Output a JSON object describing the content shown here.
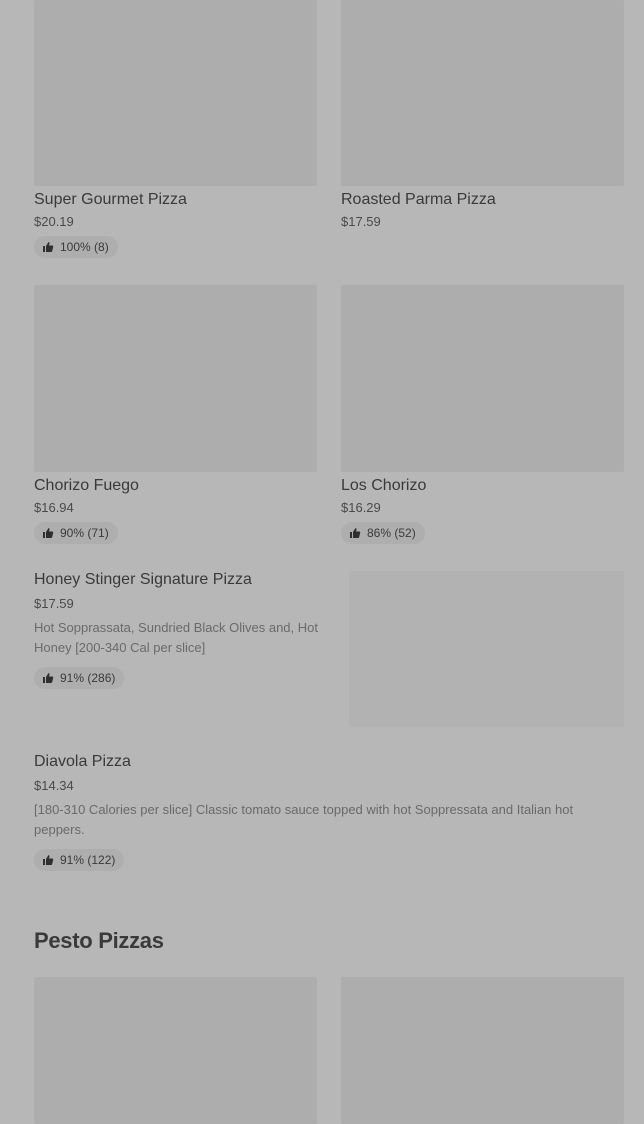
{
  "menu": {
    "grid_items": [
      {
        "title": "Super Gourmet Pizza",
        "price": "$20.19",
        "rating": "100% (8)"
      },
      {
        "title": "Roasted Parma Pizza",
        "price": "$17.59",
        "rating": ""
      },
      {
        "title": "Chorizo Fuego",
        "price": "$16.94",
        "rating": "90% (71)"
      },
      {
        "title": "Los Chorizo",
        "price": "$16.29",
        "rating": "86% (52)"
      }
    ],
    "list_items": [
      {
        "title": "Honey Stinger Signature Pizza",
        "price": "$17.59",
        "description": "Hot Sopprassata, Sundried Black Olives and, Hot Honey [200-340 Cal per slice]",
        "rating": "91% (286)"
      },
      {
        "title": "Diavola Pizza",
        "price": "$14.34",
        "description": "[180-310 Calories per slice] Classic tomato sauce topped with hot Soppressata and Italian hot peppers.",
        "rating": "91% (122)"
      }
    ]
  },
  "sections": {
    "pesto_title": "Pesto Pizzas"
  },
  "icons": {
    "rating": "thumbs-up-icon"
  },
  "colors": {
    "overlay_background": "#b7b7b7",
    "placeholder": "#adadad",
    "text": "#3a3a3a"
  }
}
